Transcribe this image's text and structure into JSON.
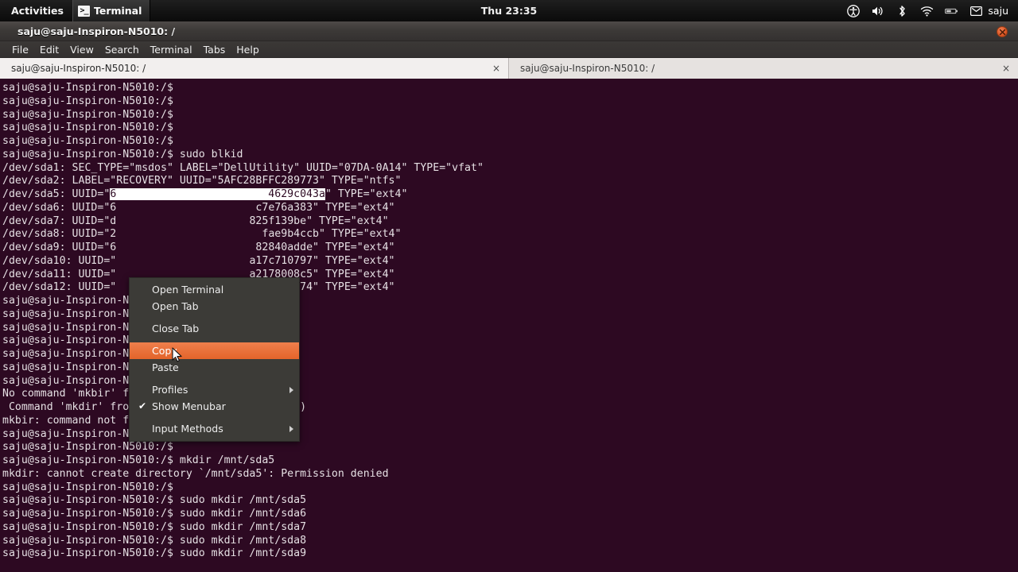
{
  "panel": {
    "activities": "Activities",
    "app_name": "Terminal",
    "app_icon": "terminal-prompt-icon",
    "terminal_glyph": ">_",
    "clock": "Thu 23:35",
    "tray": [
      {
        "name": "accessibility-icon",
        "label": "Universal Access"
      },
      {
        "name": "volume-icon",
        "label": "Volume"
      },
      {
        "name": "bluetooth-icon",
        "label": "Bluetooth"
      },
      {
        "name": "wifi-icon",
        "label": "Wi-Fi"
      },
      {
        "name": "battery-icon",
        "label": "Battery"
      }
    ],
    "user": "saju"
  },
  "window": {
    "title": "saju@saju-Inspiron-N5010: /",
    "close_label": "×",
    "menubar": [
      "File",
      "Edit",
      "View",
      "Search",
      "Terminal",
      "Tabs",
      "Help"
    ],
    "tabs": [
      {
        "label": "saju@saju-Inspiron-N5010: /",
        "close": "×",
        "active": true
      },
      {
        "label": "saju@saju-Inspiron-N5010: /",
        "close": "×",
        "active": false
      }
    ]
  },
  "terminal": {
    "prompt": "saju@saju-Inspiron-N5010:/$",
    "background": "#2d0922",
    "foreground": "#e6e0e4",
    "selection_background": "#ffffff",
    "lines": [
      {
        "text": "saju@saju-Inspiron-N5010:/$"
      },
      {
        "text": "saju@saju-Inspiron-N5010:/$"
      },
      {
        "text": "saju@saju-Inspiron-N5010:/$"
      },
      {
        "text": "saju@saju-Inspiron-N5010:/$"
      },
      {
        "text": "saju@saju-Inspiron-N5010:/$"
      },
      {
        "text": "saju@saju-Inspiron-N5010:/$ sudo blkid"
      },
      {
        "text": "/dev/sda1: SEC_TYPE=\"msdos\" LABEL=\"DellUtility\" UUID=\"07DA-0A14\" TYPE=\"vfat\""
      },
      {
        "text": "/dev/sda2: LABEL=\"RECOVERY\" UUID=\"5AFC28BFFC289773\" TYPE=\"ntfs\""
      },
      {
        "pre": "/dev/sda5: UUID=\"",
        "selected": "6                        4629c043a",
        "post": "\" TYPE=\"ext4\""
      },
      {
        "pre": "/dev/sda6: UUID=\"6",
        "hidden": "                      ",
        "post": "c7e76a383\" TYPE=\"ext4\""
      },
      {
        "pre": "/dev/sda7: UUID=\"d",
        "hidden": "                     ",
        "post": "825f139be\" TYPE=\"ext4\""
      },
      {
        "pre": "/dev/sda8: UUID=\"2",
        "hidden": "                       ",
        "post": "fae9b4ccb\" TYPE=\"ext4\""
      },
      {
        "pre": "/dev/sda9: UUID=\"6",
        "hidden": "                      ",
        "post": "82840adde\" TYPE=\"ext4\""
      },
      {
        "pre": "/dev/sda10: UUID=\"",
        "hidden": "                     ",
        "post": "a17c710797\" TYPE=\"ext4\""
      },
      {
        "pre": "/dev/sda11: UUID=\"",
        "hidden": "                     ",
        "post": "a2178008c5\" TYPE=\"ext4\""
      },
      {
        "pre": "/dev/sda12: UUID=\"",
        "hidden": "                     ",
        "post": "bf8abe5b74\" TYPE=\"ext4\""
      },
      {
        "text": "saju@saju-Inspiron-N5010:/$"
      },
      {
        "text": "saju@saju-Inspiron-N5010:/$"
      },
      {
        "text": "saju@saju-Inspiron-N5010:/$"
      },
      {
        "text": "saju@saju-Inspiron-N5010:/$"
      },
      {
        "text": "saju@saju-Inspiron-N5010:/$"
      },
      {
        "text": "saju@saju-Inspiron-N5010:/$"
      },
      {
        "text": "saju@saju-Inspiron-N5010:/$ mkbir /mnt/sda5"
      },
      {
        "text": "No command 'mkbir' found, did you mean:"
      },
      {
        "text": " Command 'mkdir' from package 'coreutils' (main)"
      },
      {
        "text": "mkbir: command not found"
      },
      {
        "text": "saju@saju-Inspiron-N5010:/$"
      },
      {
        "text": "saju@saju-Inspiron-N5010:/$"
      },
      {
        "text": "saju@saju-Inspiron-N5010:/$ mkdir /mnt/sda5"
      },
      {
        "text": "mkdir: cannot create directory `/mnt/sda5': Permission denied"
      },
      {
        "text": "saju@saju-Inspiron-N5010:/$"
      },
      {
        "text": "saju@saju-Inspiron-N5010:/$ sudo mkdir /mnt/sda5"
      },
      {
        "text": "saju@saju-Inspiron-N5010:/$ sudo mkdir /mnt/sda6"
      },
      {
        "text": "saju@saju-Inspiron-N5010:/$ sudo mkdir /mnt/sda7"
      },
      {
        "text": "saju@saju-Inspiron-N5010:/$ sudo mkdir /mnt/sda8"
      },
      {
        "text": "saju@saju-Inspiron-N5010:/$ sudo mkdir /mnt/sda9"
      }
    ]
  },
  "context_menu": {
    "highlight_color": "#e4642a",
    "background": "#3c3b37",
    "items": [
      {
        "label": "Open Terminal",
        "type": "item"
      },
      {
        "label": "Open Tab",
        "type": "item"
      },
      {
        "type": "gap"
      },
      {
        "label": "Close Tab",
        "type": "item"
      },
      {
        "type": "gap"
      },
      {
        "label": "Copy",
        "type": "item",
        "selected": true
      },
      {
        "label": "Paste",
        "type": "item"
      },
      {
        "type": "gap"
      },
      {
        "label": "Profiles",
        "type": "submenu"
      },
      {
        "label": "Show Menubar",
        "type": "check",
        "checked": true,
        "check_glyph": "✔"
      },
      {
        "type": "gap"
      },
      {
        "label": "Input Methods",
        "type": "submenu"
      }
    ]
  }
}
